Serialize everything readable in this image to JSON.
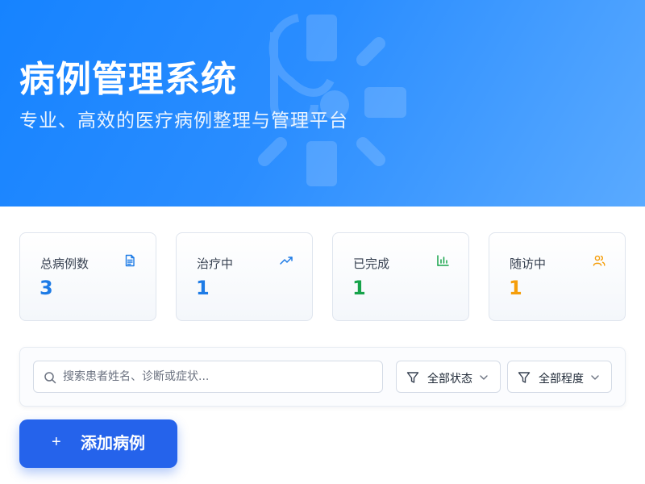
{
  "header": {
    "title": "病例管理系统",
    "subtitle": "专业、高效的医疗病例整理与管理平台"
  },
  "stats": [
    {
      "label": "总病例数",
      "value": "3",
      "icon": "document-icon",
      "color": "#1d7be6"
    },
    {
      "label": "治疗中",
      "value": "1",
      "icon": "trending-up-icon",
      "color": "#1d7be6"
    },
    {
      "label": "已完成",
      "value": "1",
      "icon": "bar-chart-icon",
      "color": "#16a34a"
    },
    {
      "label": "随访中",
      "value": "1",
      "icon": "users-icon",
      "color": "#f59e0b"
    }
  ],
  "search": {
    "placeholder": "搜索患者姓名、诊断或症状...",
    "value": ""
  },
  "filters": {
    "status": {
      "label": "全部状态",
      "icon": "filter-icon"
    },
    "severity": {
      "label": "全部程度",
      "icon": "filter-icon"
    }
  },
  "actions": {
    "add_case_icon": "+",
    "add_case_label": "添加病例"
  },
  "colors": {
    "hero_gradient_start": "#1683ff",
    "hero_gradient_end": "#5aaaff",
    "accent": "#2563eb"
  }
}
